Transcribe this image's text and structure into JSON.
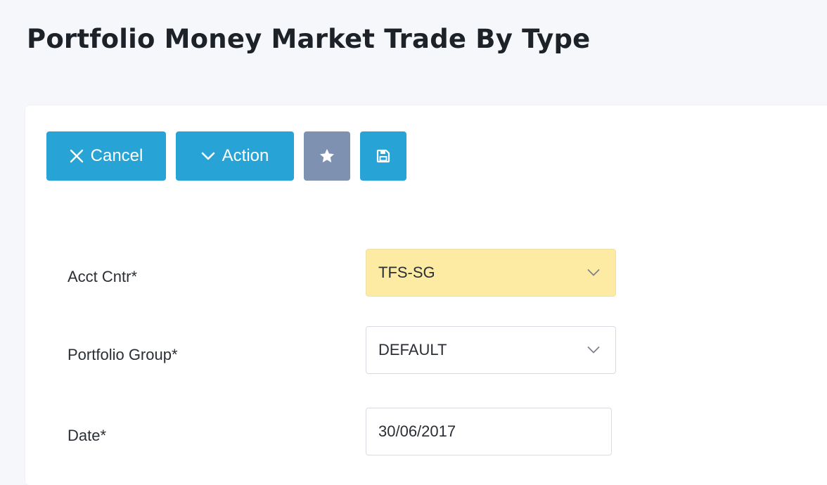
{
  "page": {
    "title": "Portfolio Money Market Trade By Type"
  },
  "toolbar": {
    "cancel": {
      "label": "Cancel",
      "icon": "close-icon"
    },
    "action": {
      "label": "Action",
      "icon": "chevron-down-icon"
    },
    "favorite": {
      "icon": "star-icon"
    },
    "save": {
      "icon": "save-icon"
    }
  },
  "form": {
    "acct_cntr": {
      "label": "Acct Cntr*",
      "value": "TFS-SG",
      "highlight_color": "#fdeaa3"
    },
    "portfolio_group": {
      "label": "Portfolio Group*",
      "value": "DEFAULT"
    },
    "date": {
      "label": "Date*",
      "value": "30/06/2017"
    }
  },
  "colors": {
    "primary_button": "#27a3d6",
    "secondary_button": "#7f91b1",
    "background": "#f5f7fa"
  }
}
